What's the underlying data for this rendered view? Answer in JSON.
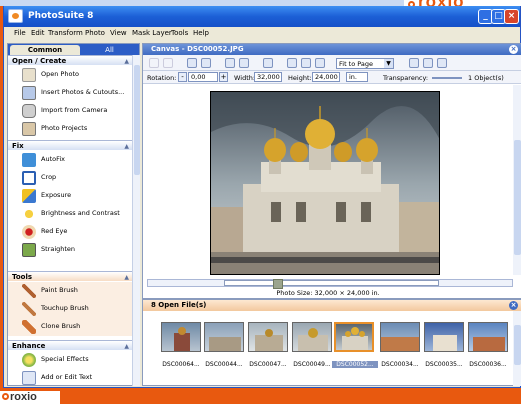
{
  "app": {
    "title": "PhotoSuite 8",
    "brand": "roxio",
    "brand_accent": "#e8590f",
    "titlebar_color": "#1c5fd6"
  },
  "window_controls": {
    "minimize": "_",
    "maximize": "□",
    "close": "×"
  },
  "menu": [
    "File",
    "Edit",
    "Transform",
    "Photo",
    "View",
    "Mask Layer",
    "Tools",
    "Help"
  ],
  "tabs": {
    "common": "Common",
    "all": "All"
  },
  "sections": [
    {
      "title": "Open / Create",
      "items": [
        {
          "label": "Open Photo",
          "icon": "open-photo-icon"
        },
        {
          "label": "Insert Photos & Cutouts...",
          "icon": "insert-photos-icon"
        },
        {
          "label": "Import from Camera",
          "icon": "camera-icon"
        },
        {
          "label": "Photo Projects",
          "icon": "photo-projects-icon"
        }
      ]
    },
    {
      "title": "Fix",
      "items": [
        {
          "label": "AutoFix",
          "icon": "autofix-icon"
        },
        {
          "label": "Crop",
          "icon": "crop-icon"
        },
        {
          "label": "Exposure",
          "icon": "exposure-icon"
        },
        {
          "label": "Brightness and Contrast",
          "icon": "brightness-icon"
        },
        {
          "label": "Red Eye",
          "icon": "red-eye-icon"
        },
        {
          "label": "Straighten",
          "icon": "straighten-icon"
        }
      ]
    },
    {
      "title": "Tools",
      "items": [
        {
          "label": "Paint Brush",
          "icon": "paint-brush-icon"
        },
        {
          "label": "Touchup Brush",
          "icon": "touchup-brush-icon"
        },
        {
          "label": "Clone Brush",
          "icon": "clone-brush-icon"
        }
      ]
    },
    {
      "title": "Enhance",
      "items": [
        {
          "label": "Special Effects",
          "icon": "special-effects-icon"
        },
        {
          "label": "Add or Edit Text",
          "icon": "text-icon"
        }
      ]
    }
  ],
  "canvas": {
    "title": "Canvas - DSC00052.JPG",
    "fit": "Fit to Page",
    "rotation_label": "Rotation:",
    "rotation": "0,00",
    "width_label": "Width:",
    "width": "32,000",
    "height_label": "Height:",
    "height": "24,000",
    "unit": "in.",
    "transparency_label": "Transparency:",
    "objects": "1 Object(s)",
    "photo_size": "Photo Size: 32,000 × 24,000 in."
  },
  "files": {
    "title": "8 Open File(s)",
    "thumbnails": [
      "DSC00064...",
      "DSC00044...",
      "DSC00047...",
      "DSC00049...",
      "DSC00052...",
      "DSC00034...",
      "DSC00035...",
      "DSC00036..."
    ],
    "selected_index": 4
  }
}
